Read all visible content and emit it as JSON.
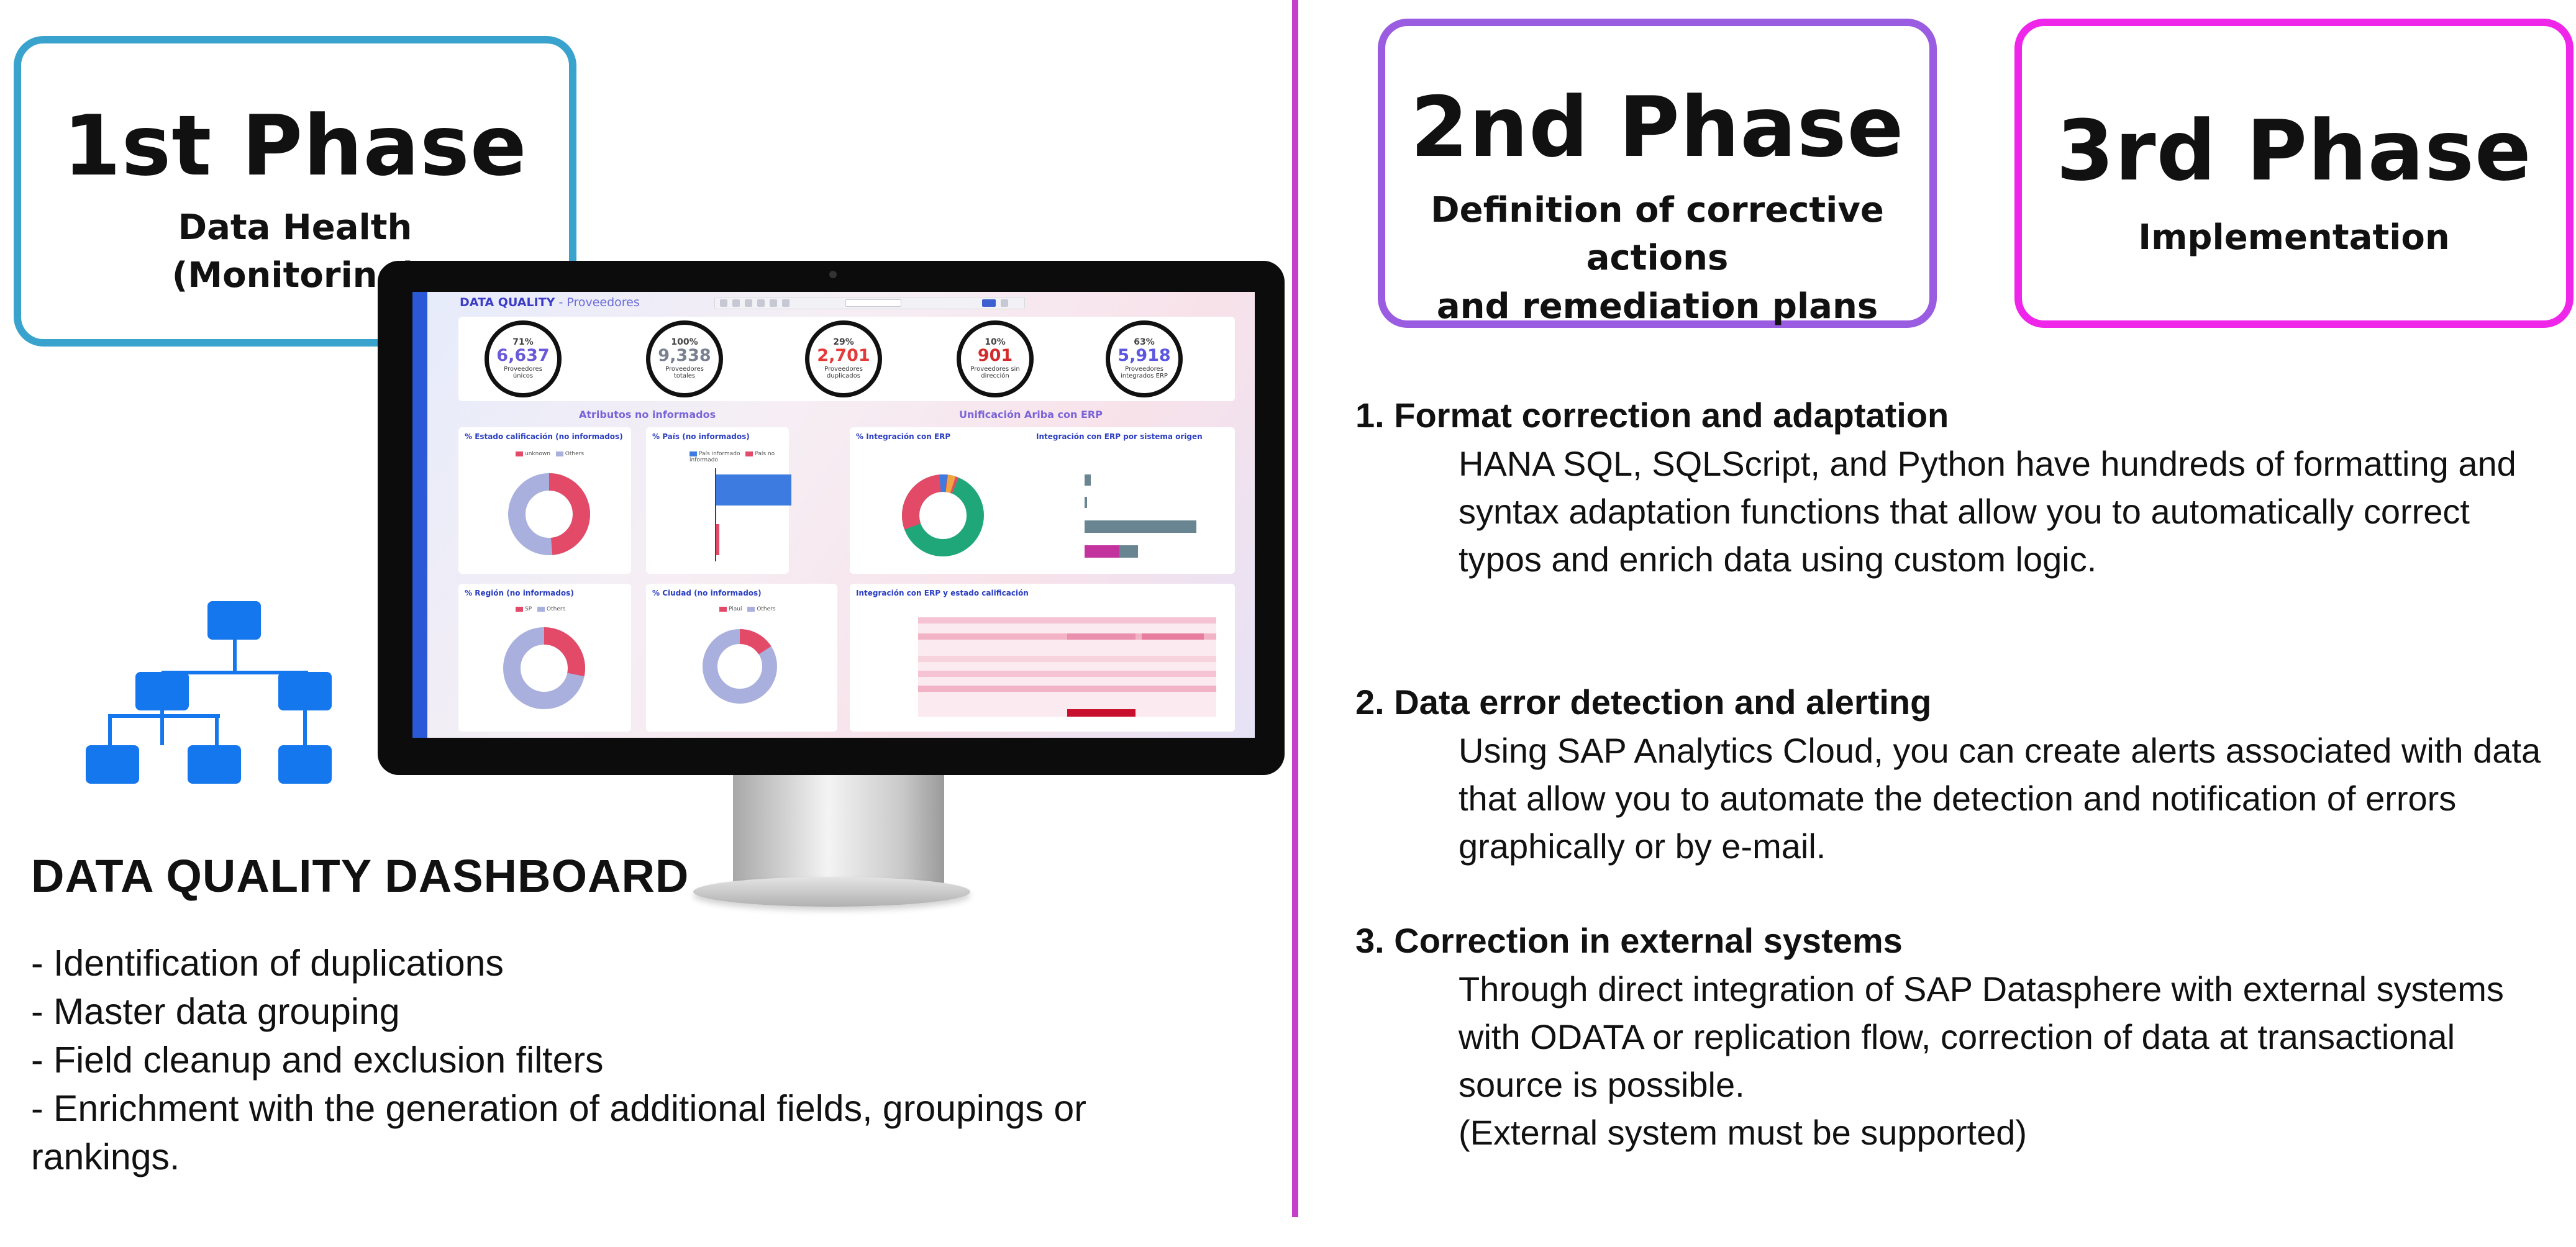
{
  "phases": [
    {
      "title": "1st Phase",
      "subtitle_lines": [
        "Data Health",
        "(Monitoring)"
      ]
    },
    {
      "title": "2nd Phase",
      "subtitle_lines": [
        "Definition of corrective actions",
        "and remediation plans"
      ]
    },
    {
      "title": "3rd Phase",
      "subtitle_lines": [
        "Implementation"
      ]
    }
  ],
  "left": {
    "heading": "DATA QUALITY DASHBOARD",
    "features": [
      "- Identification of duplications",
      "- Master data grouping",
      "- Field cleanup and exclusion filters",
      "- Enrichment with the generation of additional fields, groupings or rankings."
    ]
  },
  "right": {
    "sections": [
      {
        "heading": "1. Format correction and adaptation",
        "body": "HANA SQL, SQLScript, and Python have hundreds of formatting and syntax adaptation functions that allow you to automatically correct typos and enrich data using custom logic."
      },
      {
        "heading": "2. Data error detection and alerting",
        "body": "Using SAP Analytics Cloud, you can create alerts associated with data that allow you to automate the detection and notification of errors graphically or by e-mail."
      },
      {
        "heading": "3. Correction in external systems",
        "body": "Through direct integration of SAP Datasphere with external systems with ODATA or replication flow, correction of data at transactional source is possible.",
        "note": "(External system must be supported)"
      }
    ]
  },
  "dashboard": {
    "title": "DATA QUALITY",
    "title_suffix": " - Proveedores",
    "kpis": [
      {
        "pct": "71%",
        "value": "6,637",
        "label": "Proveedores únicos",
        "color": "#6a5ad8"
      },
      {
        "pct": "100%",
        "value": "9,338",
        "label": "Proveedores totales",
        "color": "#7a8190"
      },
      {
        "pct": "29%",
        "value": "2,701",
        "label": "Proveedores duplicados",
        "color": "#e33a3a"
      },
      {
        "pct": "10%",
        "value": "901",
        "label": "Proveedores sin dirección",
        "color": "#d42c2c"
      },
      {
        "pct": "63%",
        "value": "5,918",
        "label": "Proveedores integrados ERP",
        "color": "#5b57e0"
      }
    ],
    "section_labels": [
      "Atributos no informados",
      "Unificación Ariba con ERP"
    ],
    "panels": [
      {
        "title": "% Estado calificación (no informados)"
      },
      {
        "title": "% País (no informados)"
      },
      {
        "title": "% Integración con ERP"
      },
      {
        "title": "Integración con ERP por sistema origen"
      },
      {
        "title": "% Región (no informados)"
      },
      {
        "title": "% Ciudad (no informados)"
      },
      {
        "title": "Integración con ERP y estado calificación"
      }
    ],
    "colors": {
      "accent": "#2b58d6",
      "red": "#e34a67",
      "lavender": "#a9b0de",
      "green": "#1fa77a",
      "steel": "#6a8592"
    }
  }
}
